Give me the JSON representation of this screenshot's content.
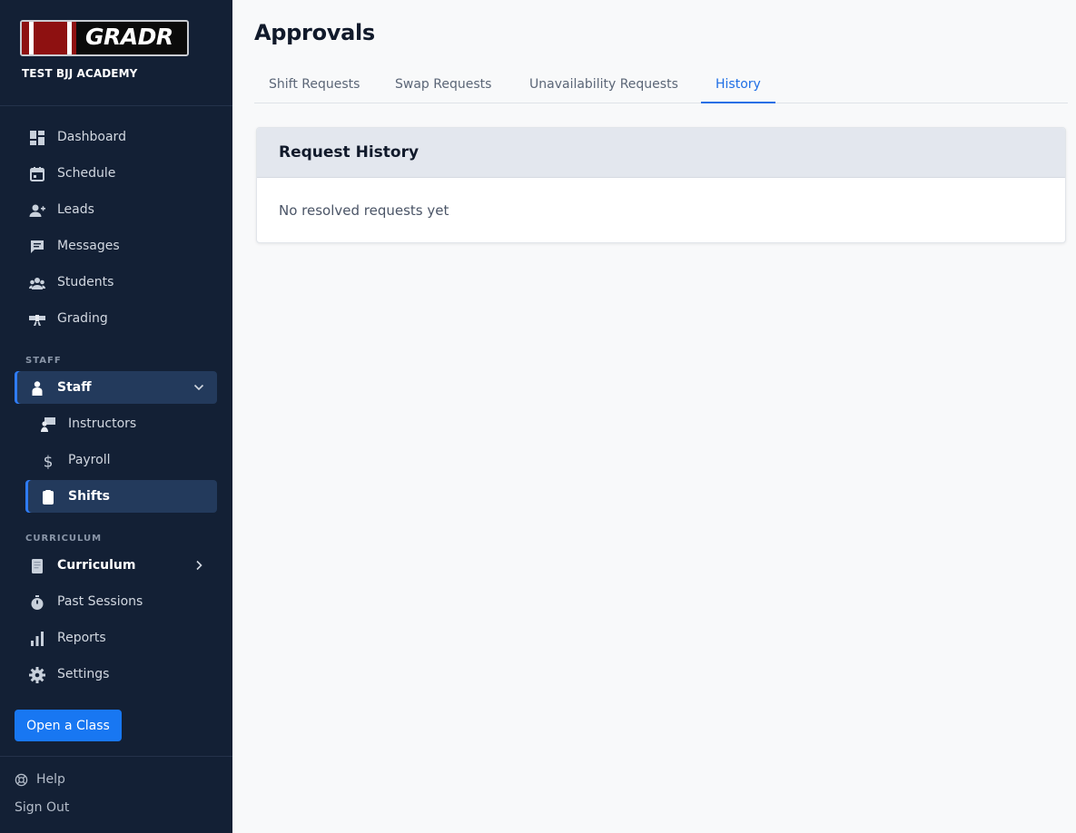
{
  "brand": {
    "logo_text": "GRADR",
    "academy_name": "TEST BJJ ACADEMY"
  },
  "sidebar": {
    "main_items": [
      {
        "label": "Dashboard",
        "icon": "dashboard-icon"
      },
      {
        "label": "Schedule",
        "icon": "calendar-icon"
      },
      {
        "label": "Leads",
        "icon": "add-person-icon"
      },
      {
        "label": "Messages",
        "icon": "chat-icon"
      },
      {
        "label": "Students",
        "icon": "group-icon"
      },
      {
        "label": "Grading",
        "icon": "belt-icon"
      }
    ],
    "staff_section_label": "STAFF",
    "staff_group": {
      "label": "Staff",
      "icon": "person-icon",
      "expanded": true
    },
    "staff_items": [
      {
        "label": "Instructors",
        "icon": "instructor-icon"
      },
      {
        "label": "Payroll",
        "icon": "dollar-icon"
      },
      {
        "label": "Shifts",
        "icon": "clipboard-icon",
        "active": true
      }
    ],
    "curriculum_section_label": "CURRICULUM",
    "curriculum_group": {
      "label": "Curriculum",
      "icon": "book-icon",
      "expanded": false
    },
    "other_items": [
      {
        "label": "Past Sessions",
        "icon": "stopwatch-icon"
      },
      {
        "label": "Reports",
        "icon": "bar-chart-icon"
      },
      {
        "label": "Settings",
        "icon": "gear-icon"
      }
    ],
    "open_class_button": "Open a Class",
    "help_label": "Help",
    "sign_out_label": "Sign Out"
  },
  "main": {
    "title": "Approvals",
    "tabs": [
      {
        "label": "Shift Requests"
      },
      {
        "label": "Swap Requests"
      },
      {
        "label": "Unavailability Requests"
      },
      {
        "label": "History",
        "active": true
      }
    ],
    "card": {
      "title": "Request History",
      "empty_text": "No resolved requests yet"
    }
  },
  "colors": {
    "sidebar_bg": "#132035",
    "accent": "#1877f2",
    "active_tab": "#1f6fe5"
  }
}
